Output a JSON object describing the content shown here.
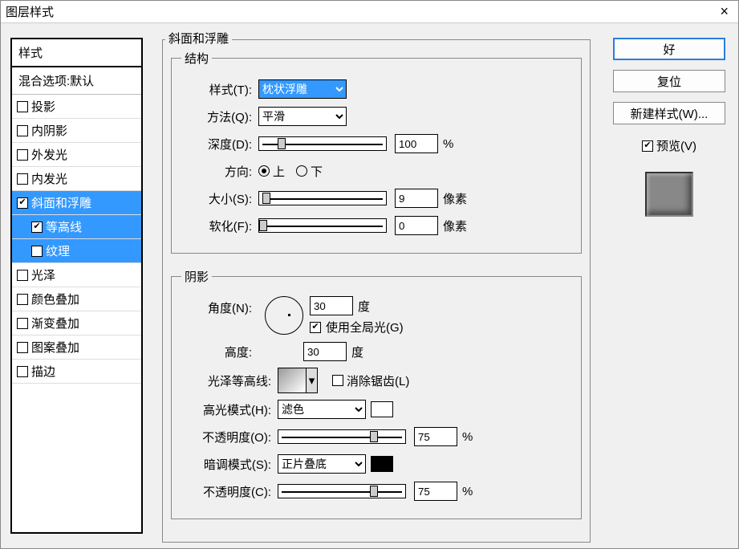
{
  "window": {
    "title": "图层样式",
    "close": "×"
  },
  "styles_panel": {
    "header": "样式",
    "blend_defaults": "混合选项:默认",
    "items": [
      {
        "label": "投影",
        "checked": false,
        "selected": false,
        "indent": false
      },
      {
        "label": "内阴影",
        "checked": false,
        "selected": false,
        "indent": false
      },
      {
        "label": "外发光",
        "checked": false,
        "selected": false,
        "indent": false
      },
      {
        "label": "内发光",
        "checked": false,
        "selected": false,
        "indent": false
      },
      {
        "label": "斜面和浮雕",
        "checked": true,
        "selected": true,
        "indent": false
      },
      {
        "label": "等高线",
        "checked": true,
        "selected": true,
        "indent": true
      },
      {
        "label": "纹理",
        "checked": false,
        "selected": true,
        "indent": true
      },
      {
        "label": "光泽",
        "checked": false,
        "selected": false,
        "indent": false
      },
      {
        "label": "颜色叠加",
        "checked": false,
        "selected": false,
        "indent": false
      },
      {
        "label": "渐变叠加",
        "checked": false,
        "selected": false,
        "indent": false
      },
      {
        "label": "图案叠加",
        "checked": false,
        "selected": false,
        "indent": false
      },
      {
        "label": "描边",
        "checked": false,
        "selected": false,
        "indent": false
      }
    ]
  },
  "main": {
    "title": "斜面和浮雕",
    "structure": {
      "legend": "结构",
      "style_label": "样式(T):",
      "style_value": "枕状浮雕",
      "technique_label": "方法(Q):",
      "technique_value": "平滑",
      "depth_label": "深度(D):",
      "depth_value": "100",
      "depth_unit": "%",
      "direction_label": "方向:",
      "direction_up": "上",
      "direction_down": "下",
      "direction_value": "up",
      "size_label": "大小(S):",
      "size_value": "9",
      "size_unit": "像素",
      "soften_label": "软化(F):",
      "soften_value": "0",
      "soften_unit": "像素"
    },
    "shading": {
      "legend": "阴影",
      "angle_label": "角度(N):",
      "angle_value": "30",
      "angle_unit": "度",
      "global_light_label": "使用全局光(G)",
      "global_light": true,
      "altitude_label": "高度:",
      "altitude_value": "30",
      "altitude_unit": "度",
      "gloss_label": "光泽等高线:",
      "antialias_label": "消除锯齿(L)",
      "antialias": false,
      "highlight_mode_label": "高光模式(H):",
      "highlight_mode": "滤色",
      "highlight_opacity_label": "不透明度(O):",
      "highlight_opacity": "75",
      "hop_unit": "%",
      "shadow_mode_label": "暗调模式(S):",
      "shadow_mode": "正片叠底",
      "shadow_opacity_label": "不透明度(C):",
      "shadow_opacity": "75",
      "sop_unit": "%",
      "highlight_color": "#ffffff",
      "shadow_color": "#000000"
    }
  },
  "sidebar": {
    "ok": "好",
    "cancel": "复位",
    "new_style": "新建样式(W)...",
    "preview_label": "预览(V)",
    "preview_checked": true
  }
}
